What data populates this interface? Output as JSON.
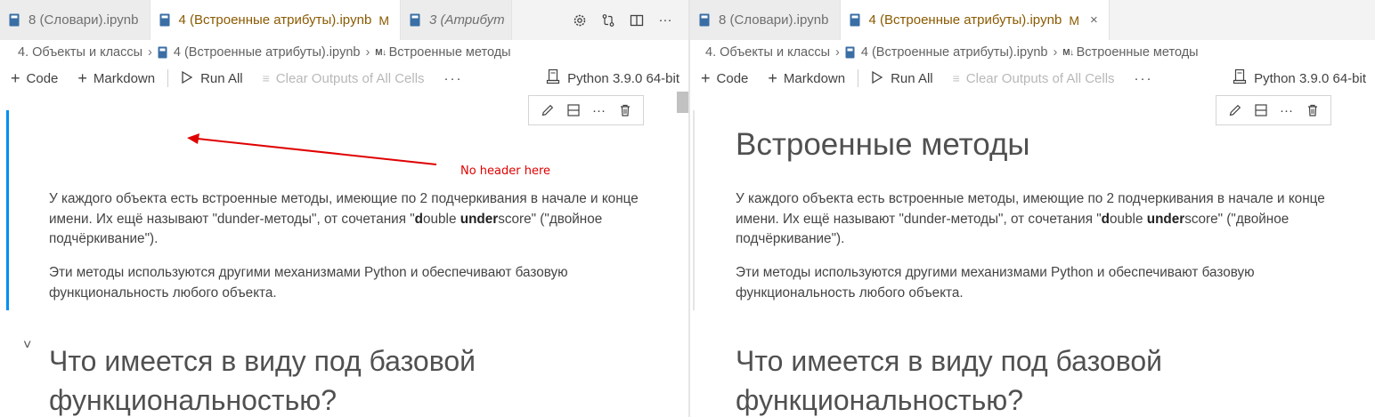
{
  "left": {
    "tabs": [
      {
        "label": "8 (Словари).ipynb",
        "active": false,
        "italic": false,
        "modified": false
      },
      {
        "label": "4 (Встроенные атрибуты).ipynb",
        "active": true,
        "italic": false,
        "modified": true,
        "mod_mark": "M",
        "close": "×"
      },
      {
        "label": "3 (Атрибут",
        "active": false,
        "italic": true,
        "modified": false
      }
    ],
    "tab_actions": [
      "settings-icon",
      "compare-icon",
      "split-editor-icon",
      "more-icon"
    ],
    "breadcrumb": {
      "folder": "4. Объекты и классы",
      "file": "4 (Встроенные атрибуты).ipynb",
      "md_mark": "M↓",
      "section": "Встроенные методы"
    },
    "toolbar": {
      "code": "Code",
      "markdown": "Markdown",
      "run_all": "Run All",
      "clear_outputs": "Clear Outputs of All Cells",
      "more": "···",
      "kernel": "Python 3.9.0 64-bit"
    },
    "content": {
      "heading": "",
      "para1_a": "У каждого объекта есть встроенные методы, имеющие по 2 подчеркивания в начале и конце имени. Их ещё называют \"dunder-методы\", от сочетания \"",
      "para1_b1": "d",
      "para1_c": "ouble ",
      "para1_b2": "under",
      "para1_d": "score\" (\"двойное подчёркивание\").",
      "para2": "Эти методы используются другими механизмами Python и обеспечивают базовую функциональность любого объекта.",
      "heading2": "Что имеется в виду под базовой функциональностью?",
      "chevron": "˅"
    },
    "annotation": {
      "text": "No header here",
      "color": "#e00000"
    }
  },
  "right": {
    "tabs": [
      {
        "label": "8 (Словари).ipynb",
        "active": false,
        "italic": false,
        "modified": false
      },
      {
        "label": "4 (Встроенные атрибуты).ipynb",
        "active": true,
        "italic": false,
        "modified": true,
        "mod_mark": "M",
        "close": "×"
      }
    ],
    "breadcrumb": {
      "folder": "4. Объекты и классы",
      "file": "4 (Встроенные атрибуты).ipynb",
      "md_mark": "M↓",
      "section": "Встроенные методы"
    },
    "toolbar": {
      "code": "Code",
      "markdown": "Markdown",
      "run_all": "Run All",
      "clear_outputs": "Clear Outputs of All Cells",
      "more": "···",
      "kernel": "Python 3.9.0 64-bit"
    },
    "content": {
      "heading": "Встроенные методы",
      "para1_a": "У каждого объекта есть встроенные методы, имеющие по 2 подчеркивания в начале и конце имени. Их ещё называют \"dunder-методы\", от сочетания \"",
      "para1_b1": "d",
      "para1_c": "ouble ",
      "para1_b2": "under",
      "para1_d": "score\" (\"двойное подчёркивание\").",
      "para2": "Эти методы используются другими механизмами Python и обеспечивают базовую функциональность любого объекта.",
      "heading2": "Что имеется в виду под базовой функциональностью?"
    }
  },
  "colors": {
    "accent_focus": "#0078d4",
    "modified_tab": "#8a5a00",
    "annotation_red": "#e00000"
  }
}
